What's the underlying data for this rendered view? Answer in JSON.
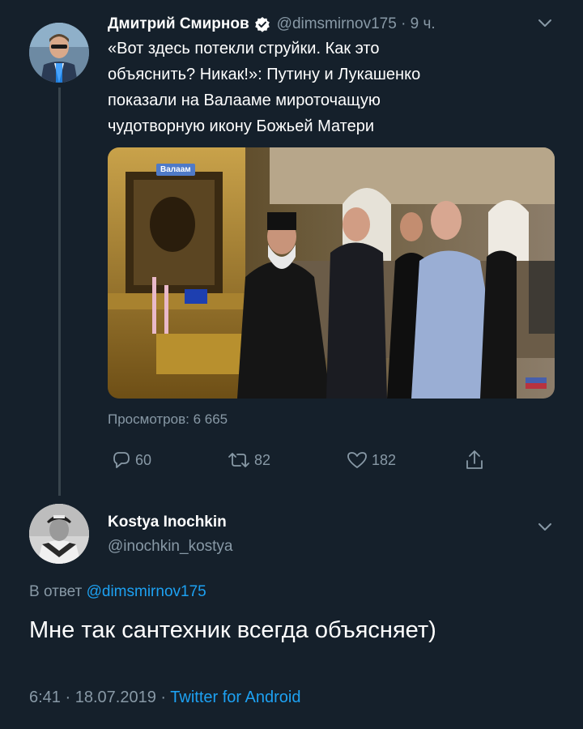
{
  "tweet": {
    "author_name": "Дмитрий Смирнов",
    "handle": "@dimsmirnov175",
    "separator": "·",
    "time": "9 ч.",
    "lines": [
      "«Вот здесь потекли струйки. Как это",
      "объяснить? Никак!»: Путину и Лукашенко",
      "показали на Валааме мироточащую",
      "чудотворную икону Божьей Матери"
    ],
    "media_badge": "Валаам",
    "views": "Просмотров: 6 665",
    "replies": "60",
    "retweets": "82",
    "likes": "182"
  },
  "reply": {
    "author_name": "Kostya Inochkin",
    "handle": "@inochkin_kostya",
    "reply_prefix": "В ответ",
    "reply_to": "@dimsmirnov175",
    "text": "Мне так сантехник всегда объясняет)",
    "time": "6:41",
    "date": "18.07.2019",
    "separator": "·",
    "client": "Twitter for Android"
  },
  "colors": {
    "background": "#15202b",
    "text_primary": "#ffffff",
    "text_secondary": "#8899a6",
    "accent": "#1da1f2",
    "thread_line": "#38444d"
  },
  "icons": {
    "verified": "verified-badge-icon",
    "caret": "chevron-down-icon",
    "reply": "reply-icon",
    "retweet": "retweet-icon",
    "like": "heart-icon",
    "share": "share-icon"
  }
}
